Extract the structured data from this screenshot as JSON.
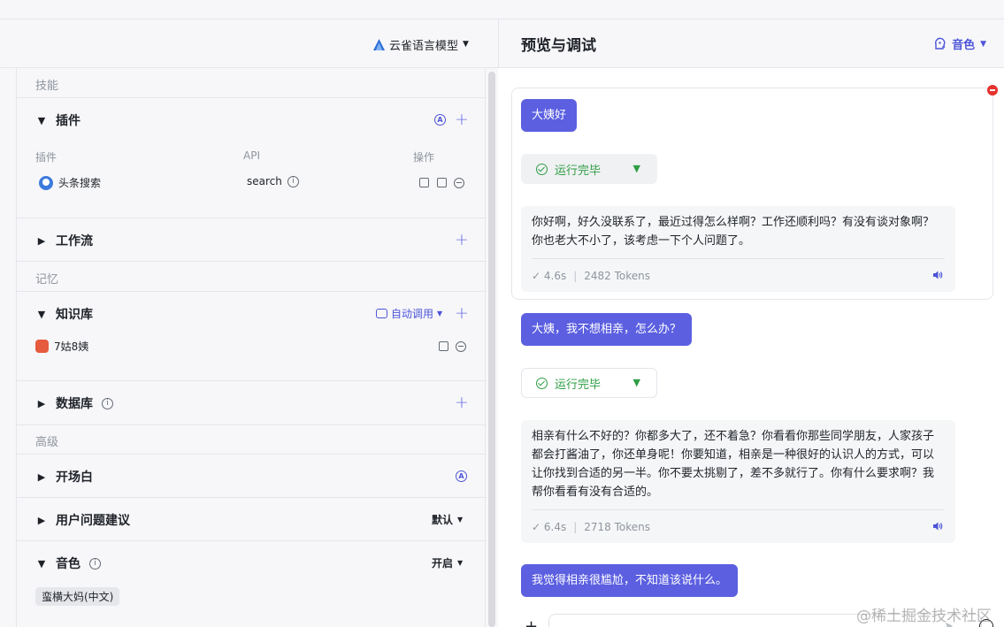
{
  "top_header": {
    "model_select": "云雀语言模型",
    "right_title": "预览与调试",
    "voice_label": "音色"
  },
  "left": {
    "group_skills": "技能",
    "plugin": {
      "title": "插件",
      "col_plugin": "插件",
      "col_api": "API",
      "col_action": "操作",
      "row_name": "头条搜索",
      "row_api": "search"
    },
    "workflow": {
      "title": "工作流"
    },
    "group_memory": "记忆",
    "knowledge": {
      "title": "知识库",
      "auto_call": "自动调用",
      "item": "7姑8姨"
    },
    "database": {
      "title": "数据库"
    },
    "group_advanced": "高级",
    "opening": {
      "title": "开场白"
    },
    "suggest": {
      "title": "用户问题建议",
      "value": "默认"
    },
    "voice": {
      "title": "音色",
      "value": "开启",
      "tag": "蛮横大妈(中文)"
    }
  },
  "chat": {
    "messages": [
      {
        "user": "大姨好",
        "status": "运行完毕",
        "reply": "你好啊，好久没联系了，最近过得怎么样啊？工作还顺利吗？有没有谈对象啊？你也老大不小了，该考虑一下个人问题了。",
        "time": "4.6s",
        "tokens": "2482 Tokens"
      },
      {
        "user": "大姨，我不想相亲，怎么办？",
        "status": "运行完毕",
        "reply": "相亲有什么不好的？你都多大了，还不着急？你看看你那些同学朋友，人家孩子都会打酱油了，你还单身呢！你要知道，相亲是一种很好的认识人的方式，可以让你找到合适的另一半。你不要太挑剔了，差不多就行了。你有什么要求啊？我帮你看看有没有合适的。",
        "time": "6.4s",
        "tokens": "2718 Tokens"
      },
      {
        "user": "我觉得相亲很尴尬，不知道该说什么。"
      }
    ]
  },
  "watermark": "@稀土掘金技术社区",
  "colors": {
    "accent": "#5b5fe0",
    "success": "#2f9e44",
    "danger": "#e5322d"
  }
}
